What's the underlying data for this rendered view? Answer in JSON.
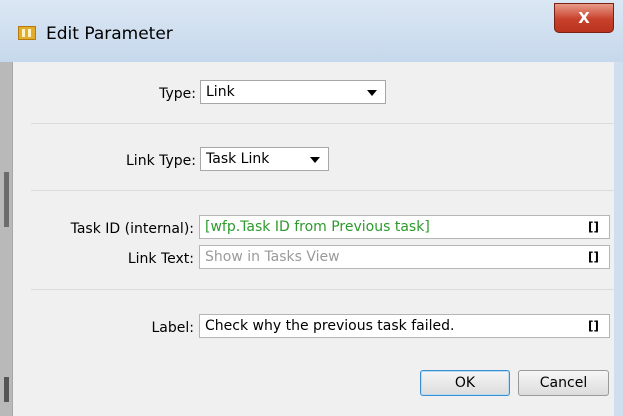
{
  "window": {
    "title": "Edit Parameter",
    "close_glyph": "X"
  },
  "form": {
    "type_label": "Type:",
    "type_value": "Link",
    "link_type_label": "Link Type:",
    "link_type_value": "Task Link",
    "task_id_label": "Task ID (internal):",
    "task_id_value": "[wfp.Task ID from Previous task]",
    "link_text_label": "Link Text:",
    "link_text_placeholder": "Show in Tasks View",
    "label_label": "Label:",
    "label_value": "Check why the previous task failed.",
    "field_menu_glyph": "[]"
  },
  "buttons": {
    "ok": "OK",
    "cancel": "Cancel"
  },
  "colors": {
    "value_green": "#2c9a2c",
    "placeholder_grey": "#9a9a9a",
    "close_red": "#c7402b"
  }
}
